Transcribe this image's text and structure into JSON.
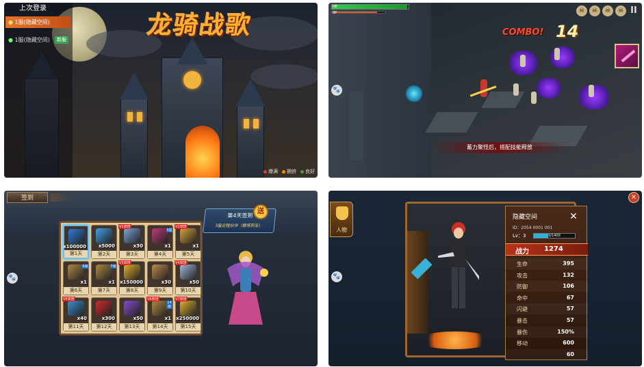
{
  "panel_login": {
    "server_list_header": "上次登录",
    "active_server": "1服(隐藏空间)",
    "server_item": "1服(隐藏空间)",
    "server_item_badge": "新服",
    "logo_text": "龙骑战歌",
    "legend": [
      {
        "label": "爆满",
        "color": "#e53935"
      },
      {
        "label": "拥挤",
        "color": "#fb8c00"
      },
      {
        "label": "良好",
        "color": "#43a047"
      }
    ]
  },
  "panel_battle": {
    "hp_label": "HP",
    "sp_label": "SP",
    "hp_fraction": 0.98,
    "sp_fraction": 0.85,
    "combo_label": "COMBO!",
    "combo_count": "14",
    "pause_symbol": "II",
    "hint_text": "蓄力聚怪后，搭配技能释放",
    "skulls_icon": "skull-icon",
    "skull_count": 4
  },
  "panel_checkin": {
    "tab_label": "签到",
    "banner_title": "第4天签到",
    "banner_subtitle": "3星近程伙伴（娜塔莉亚）",
    "stamp": "送",
    "cells": [
      {
        "qty": "x100000",
        "day": "第1天",
        "color": "#2e7bd8",
        "vip": "",
        "selected": true
      },
      {
        "qty": "x5000",
        "day": "第2天",
        "color": "#3fa0e8",
        "vip": "",
        "selected": false
      },
      {
        "qty": "x30",
        "day": "第3天",
        "color": "#7aa6d8",
        "vip": "V1双倍",
        "selected": false
      },
      {
        "qty": "x1",
        "day": "第4天",
        "color": "#c23b7a",
        "vip": "",
        "corner": "3星",
        "selected": false
      },
      {
        "qty": "x1",
        "day": "第5天",
        "color": "#d8a23a",
        "vip": "V2双倍",
        "selected": false
      },
      {
        "qty": "x1",
        "day": "第6天",
        "color": "#b08840",
        "vip": "",
        "corner": "6级",
        "selected": false
      },
      {
        "qty": "x1",
        "day": "第7天",
        "color": "#b08840",
        "vip": "",
        "corner": "7级",
        "selected": false
      },
      {
        "qty": "x150000",
        "day": "第8天",
        "color": "#e0b030",
        "vip": "V3双倍",
        "selected": false
      },
      {
        "qty": "x30",
        "day": "第9天",
        "color": "#c08a4a",
        "vip": "",
        "selected": false
      },
      {
        "qty": "x50",
        "day": "第10天",
        "color": "#a0b8d8",
        "vip": "V4双倍",
        "selected": false
      },
      {
        "qty": "x40",
        "day": "第11天",
        "color": "#3a90d0",
        "vip": "V5双倍",
        "selected": false
      },
      {
        "qty": "x300",
        "day": "第12天",
        "color": "#d02a2a",
        "vip": "",
        "selected": false
      },
      {
        "qty": "x50",
        "day": "第13天",
        "color": "#8a4ad0",
        "vip": "",
        "selected": false
      },
      {
        "qty": "x1",
        "day": "第14天",
        "color": "#b08840",
        "vip": "V6双倍",
        "corner": "14级",
        "selected": false
      },
      {
        "qty": "x250000",
        "day": "第15天",
        "color": "#e0b030",
        "vip": "V7双倍",
        "selected": false
      }
    ]
  },
  "panel_hero": {
    "tab_label": "人物",
    "close_symbol": "×",
    "name": "隐藏空间",
    "id_line": "ID：2054 0001 001",
    "level_label": "Lv：3",
    "exp_text": "0/1400",
    "exp_fraction": 0.35,
    "power_label": "战力",
    "power_value": "1274",
    "stats": [
      {
        "label": "生命",
        "value": "395"
      },
      {
        "label": "攻击",
        "value": "132"
      },
      {
        "label": "防御",
        "value": "106"
      },
      {
        "label": "命中",
        "value": "67"
      },
      {
        "label": "闪避",
        "value": "57"
      },
      {
        "label": "暴击",
        "value": "57"
      },
      {
        "label": "暴伤",
        "value": "150%"
      },
      {
        "label": "移动",
        "value": "600"
      },
      {
        "label": "",
        "value": "60"
      }
    ]
  },
  "paw_icon": "paw-icon"
}
